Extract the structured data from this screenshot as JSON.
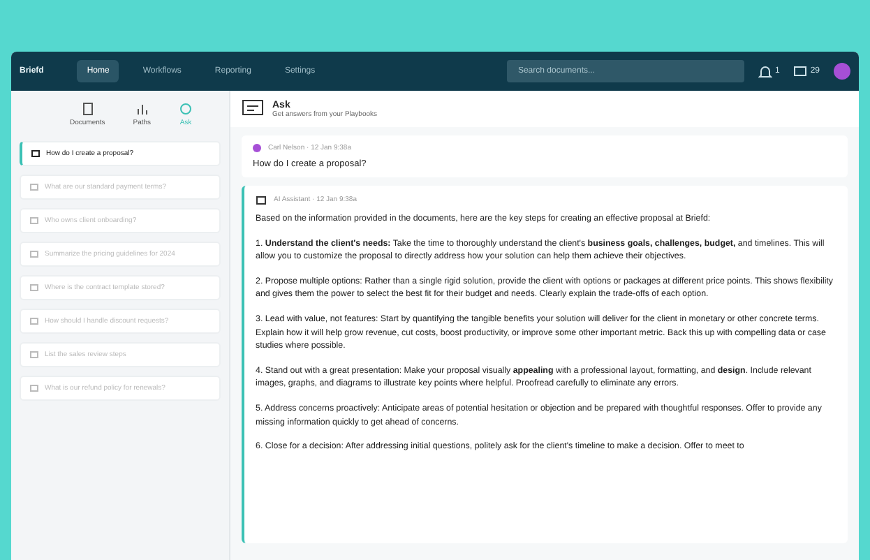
{
  "nav": {
    "brand": "Briefd",
    "tabs": [
      {
        "label": "Home",
        "selected": true
      },
      {
        "label": "Workflows",
        "selected": false
      },
      {
        "label": "Reporting",
        "selected": false
      },
      {
        "label": "Settings",
        "selected": false
      }
    ],
    "search": {
      "placeholder": "Search documents..."
    },
    "count": "1",
    "counter": "29"
  },
  "sidebar": {
    "tabs": [
      {
        "label": "Documents",
        "selected": false
      },
      {
        "label": "Paths",
        "selected": false
      },
      {
        "label": "Ask",
        "selected": true
      }
    ],
    "items": [
      {
        "text": "How do I create a proposal?",
        "selected": true
      },
      {
        "text": "What are our standard payment terms?",
        "selected": false
      },
      {
        "text": "Who owns client onboarding?",
        "selected": false
      },
      {
        "text": "Summarize the pricing guidelines for 2024",
        "selected": false
      },
      {
        "text": "Where is the contract template stored?",
        "selected": false
      },
      {
        "text": "How should I handle discount requests?",
        "selected": false
      },
      {
        "text": "List the sales review steps",
        "selected": false
      },
      {
        "text": "What is our refund policy for renewals?",
        "selected": false
      }
    ]
  },
  "header": {
    "title": "Ask",
    "subtitle": "Get answers from your Playbooks"
  },
  "question": {
    "author": "Carl Nelson · 12 Jan 9:38a",
    "text": "How do I create a proposal?"
  },
  "answer": {
    "author": "AI Assistant · 12 Jan 9:38a",
    "paragraphs": [
      "Based on the information provided in the documents, here are the key steps for creating an effective proposal at Briefd:",
      "1. **Understand the client's needs:** Take the time to thoroughly understand the client's **business goals, challenges, budget,** and timelines. This will allow you to customize the proposal to directly address how your solution can help them achieve their objectives.",
      "2. Propose multiple options: Rather than a single rigid solution, provide the client with options or packages at different price points. This shows flexibility and gives them the power to select the best fit for their budget and needs. Clearly explain the trade-offs of each option.",
      "3. Lead with value, not features: Start by quantifying the tangible benefits your solution will deliver for the client in monetary or other concrete terms. Explain how it will help grow revenue, cut costs, boost productivity, or improve some other important metric. Back this up with compelling data or case studies where possible.",
      "4. Stand out with a great presentation: Make your proposal visually **appealing** with a professional layout, formatting, and **design**. Include relevant images, graphs, and diagrams to illustrate key points where helpful. Proofread carefully to eliminate any errors.",
      "5. Address concerns proactively: Anticipate areas of potential hesitation or objection and be prepared with thoughtful responses. Offer to provide any missing information quickly to get ahead of concerns.",
      "6. Close for a decision: After addressing initial questions, politely ask for the client's timeline to make a decision. Offer to meet to"
    ]
  }
}
